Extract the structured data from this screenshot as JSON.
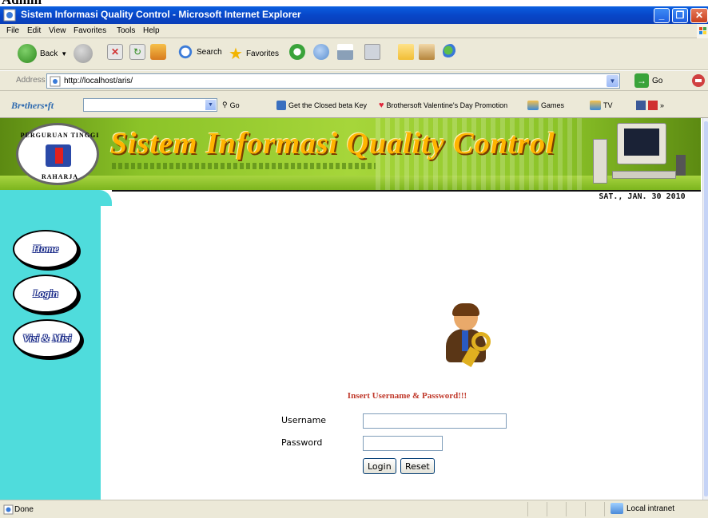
{
  "doc_header_text": "Admin",
  "window": {
    "title": "Sistem Informasi Quality Control - Microsoft Internet Explorer",
    "minimize": "_",
    "maximize": "❐",
    "close": "✕"
  },
  "menu": [
    "File",
    "Edit",
    "View",
    "Favorites",
    "Tools",
    "Help"
  ],
  "toolbar": {
    "back": "Back",
    "search": "Search",
    "favorites": "Favorites"
  },
  "address": {
    "label": "Address",
    "url": "http://localhost/aris/",
    "go": "Go"
  },
  "linksbar": {
    "brand": "Br•thers•ft",
    "go": "Go",
    "links": [
      "Get the Closed beta Key",
      "Brothersoft Valentine's Day Promotion",
      "Games",
      "TV"
    ]
  },
  "site": {
    "title": "Sistem Informasi Quality Control",
    "date": "SAT., JAN. 30  2010",
    "logo_top": "PERGURUAN TINGGI",
    "logo_bottom": "RAHARJA",
    "colors": {
      "header_green": "#8bc328",
      "sidebar_teal": "#4fdcdc",
      "title_gold": "#ffb400",
      "message_red": "#c0392b"
    }
  },
  "nav": [
    {
      "label": "Home"
    },
    {
      "label": "Login"
    },
    {
      "label": "Visi & Misi"
    }
  ],
  "login": {
    "message": "Insert Username & Password!!!",
    "username_label": "Username",
    "username_value": "",
    "password_label": "Password",
    "password_value": "",
    "login_button": "Login",
    "reset_button": "Reset"
  },
  "status": {
    "text": "Done",
    "zone": "Local intranet"
  }
}
